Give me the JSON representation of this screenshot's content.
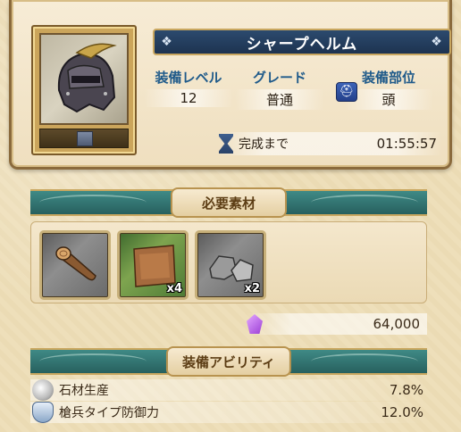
{
  "item": {
    "name": "シャープヘルム",
    "stats": [
      {
        "label": "装備レベル",
        "value": "12"
      },
      {
        "label": "グレード",
        "value": "普通"
      },
      {
        "label": "装備部位",
        "value": "頭"
      }
    ],
    "timer_label": "完成まで",
    "timer_value": "01:55:57"
  },
  "materials": {
    "header": "必要素材",
    "items": [
      {
        "icon": "wood-log-icon",
        "count": ""
      },
      {
        "icon": "leather-hide-icon",
        "count": "x4"
      },
      {
        "icon": "stone-icon",
        "count": "x2"
      }
    ],
    "cost_icon": "crystal-icon",
    "cost_value": "64,000"
  },
  "abilities": {
    "header": "装備アビリティ",
    "items": [
      {
        "icon": "stone-pile-icon",
        "label": "石材生産",
        "value": "7.8%"
      },
      {
        "icon": "shield-icon",
        "label": "槍兵タイプ防御力",
        "value": "12.0%"
      }
    ]
  }
}
